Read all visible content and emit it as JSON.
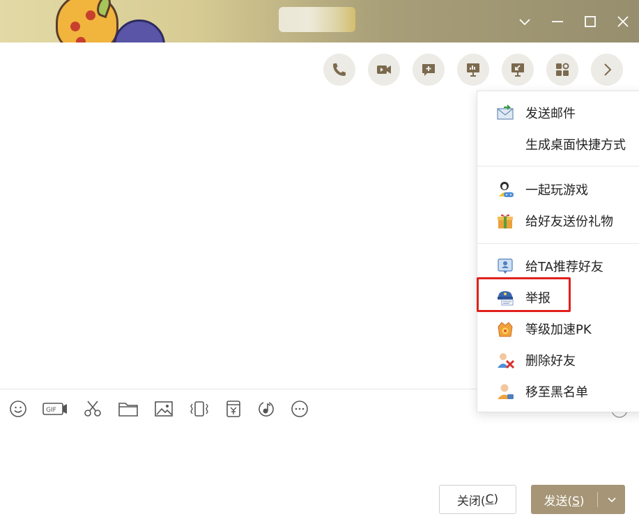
{
  "window": {
    "controls": [
      "chevron-down",
      "minimize",
      "maximize",
      "close"
    ]
  },
  "toolbar": {
    "buttons": [
      "phone-call",
      "video-call",
      "add-chat",
      "screen-share",
      "remote-desktop",
      "apps",
      "more-arrow"
    ]
  },
  "menu": {
    "items": [
      {
        "label": "发送邮件",
        "icon": "mail-send-icon"
      },
      {
        "label": "生成桌面快捷方式",
        "icon": ""
      },
      {
        "label": "一起玩游戏",
        "icon": "game-icon"
      },
      {
        "label": "给好友送份礼物",
        "icon": "gift-icon"
      },
      {
        "label": "给TA推荐好友",
        "icon": "recommend-friend-icon"
      },
      {
        "label": "举报",
        "icon": "report-icon"
      },
      {
        "label": "等级加速PK",
        "icon": "level-crown-icon"
      },
      {
        "label": "删除好友",
        "icon": "delete-friend-icon"
      },
      {
        "label": "移至黑名单",
        "icon": "blacklist-icon"
      }
    ],
    "highlight_color": "#e0201c"
  },
  "input_tools": [
    "emoji",
    "gif",
    "screenshot-scissors",
    "folder",
    "image",
    "shake",
    "red-envelope",
    "music",
    "more"
  ],
  "actions": {
    "close_label": "关闭(",
    "close_key": "C",
    "close_end": ")",
    "send_label": "发送(",
    "send_key": "S",
    "send_end": ")"
  },
  "colors": {
    "send_button": "#a69577",
    "titlebar": "#d7cc93"
  }
}
